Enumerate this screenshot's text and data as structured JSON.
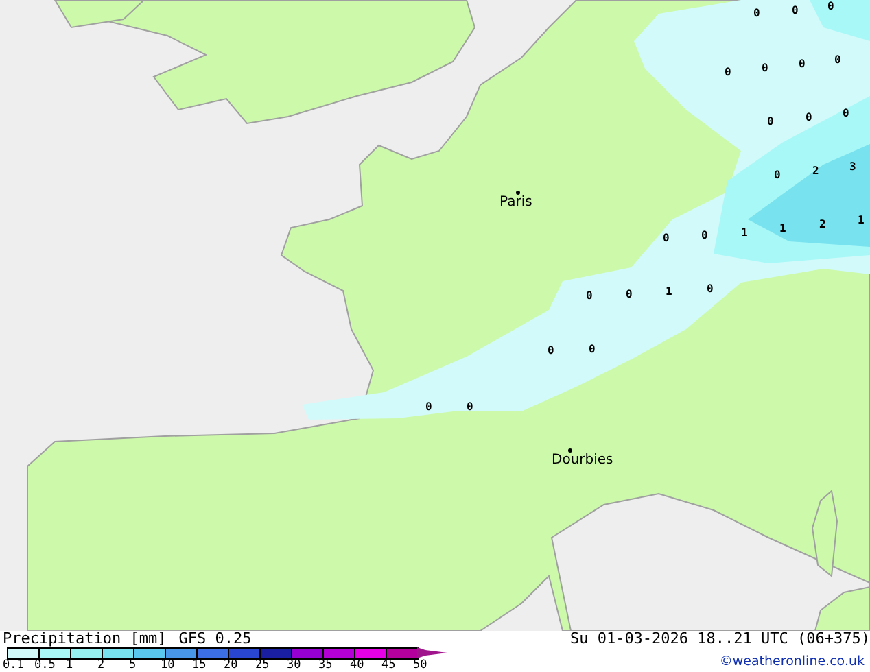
{
  "map": {
    "cities": [
      {
        "name": "Paris"
      },
      {
        "name": "Dourbies"
      }
    ],
    "value_labels": [
      "0",
      "0",
      "0",
      "0",
      "0",
      "0",
      "0",
      "0",
      "0",
      "0",
      "0",
      "2",
      "3",
      "0",
      "0",
      "1",
      "1",
      "2",
      "1",
      "0",
      "0",
      "1",
      "0",
      "0",
      "0",
      "0",
      "0"
    ]
  },
  "legend": {
    "title": "Precipitation [mm]",
    "model": "GFS 0.25",
    "timestamp": "Su 01-03-2026 18..21 UTC (06+375)",
    "credit": "©weatheronline.co.uk",
    "segments": [
      {
        "color": "#d2fafa"
      },
      {
        "color": "#a8f8f8"
      },
      {
        "color": "#96f0f0"
      },
      {
        "color": "#78e2ee"
      },
      {
        "color": "#5ac8ee"
      },
      {
        "color": "#4896e8"
      },
      {
        "color": "#3c6ee6"
      },
      {
        "color": "#2846d2"
      },
      {
        "color": "#1a1ea0"
      },
      {
        "color": "#9600d2"
      },
      {
        "color": "#b400d6"
      },
      {
        "color": "#e600e6"
      },
      {
        "color": "#b4009c"
      }
    ],
    "ticks": [
      "0.1",
      "0.5",
      "1",
      "2",
      "5",
      "10",
      "15",
      "20",
      "25",
      "30",
      "35",
      "40",
      "45",
      "50"
    ]
  }
}
